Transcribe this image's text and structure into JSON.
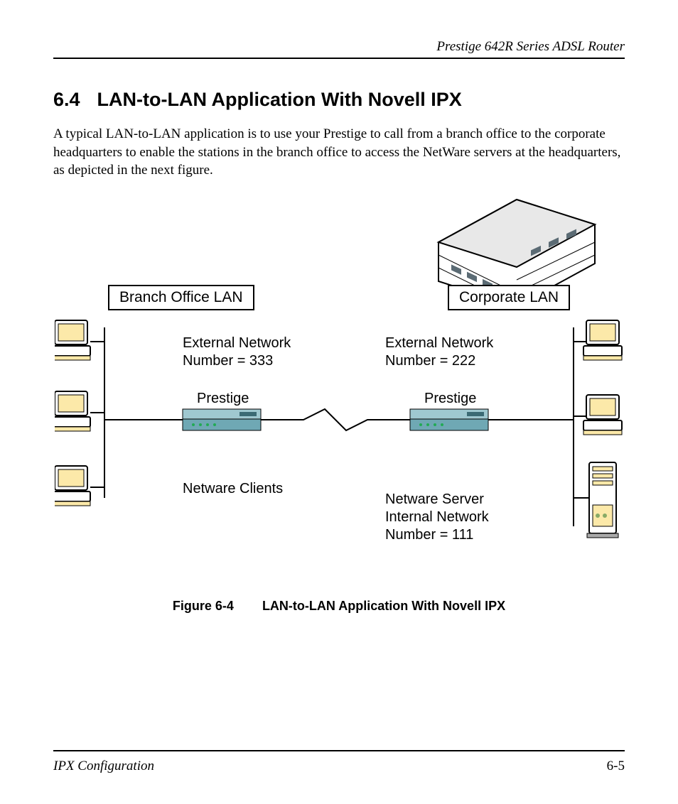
{
  "header": {
    "running_title": "Prestige 642R Series ADSL Router"
  },
  "section": {
    "number": "6.4",
    "title": "LAN-to-LAN Application With Novell IPX"
  },
  "body": {
    "paragraph": "A typical LAN-to-LAN application is to use your Prestige to call from a branch office to the corporate headquarters to enable the stations in the branch office to access the NetWare servers at the headquarters, as depicted in the next figure."
  },
  "diagram": {
    "branch_label": "Branch Office LAN",
    "corporate_label": "Corporate LAN",
    "branch_ext_net_l1": "External Network",
    "branch_ext_net_l2": "Number = 333",
    "corp_ext_net_l1": "External Network",
    "corp_ext_net_l2": "Number = 222",
    "prestige_left": "Prestige",
    "prestige_right": "Prestige",
    "netware_clients": "Netware Clients",
    "netware_server_l1": "Netware Server",
    "netware_server_l2": "Internal Network",
    "netware_server_l3": "Number = 111"
  },
  "figure": {
    "number": "Figure 6-4",
    "title": "LAN-to-LAN Application With Novell IPX"
  },
  "footer": {
    "section": "IPX Configuration",
    "page": "6-5"
  }
}
